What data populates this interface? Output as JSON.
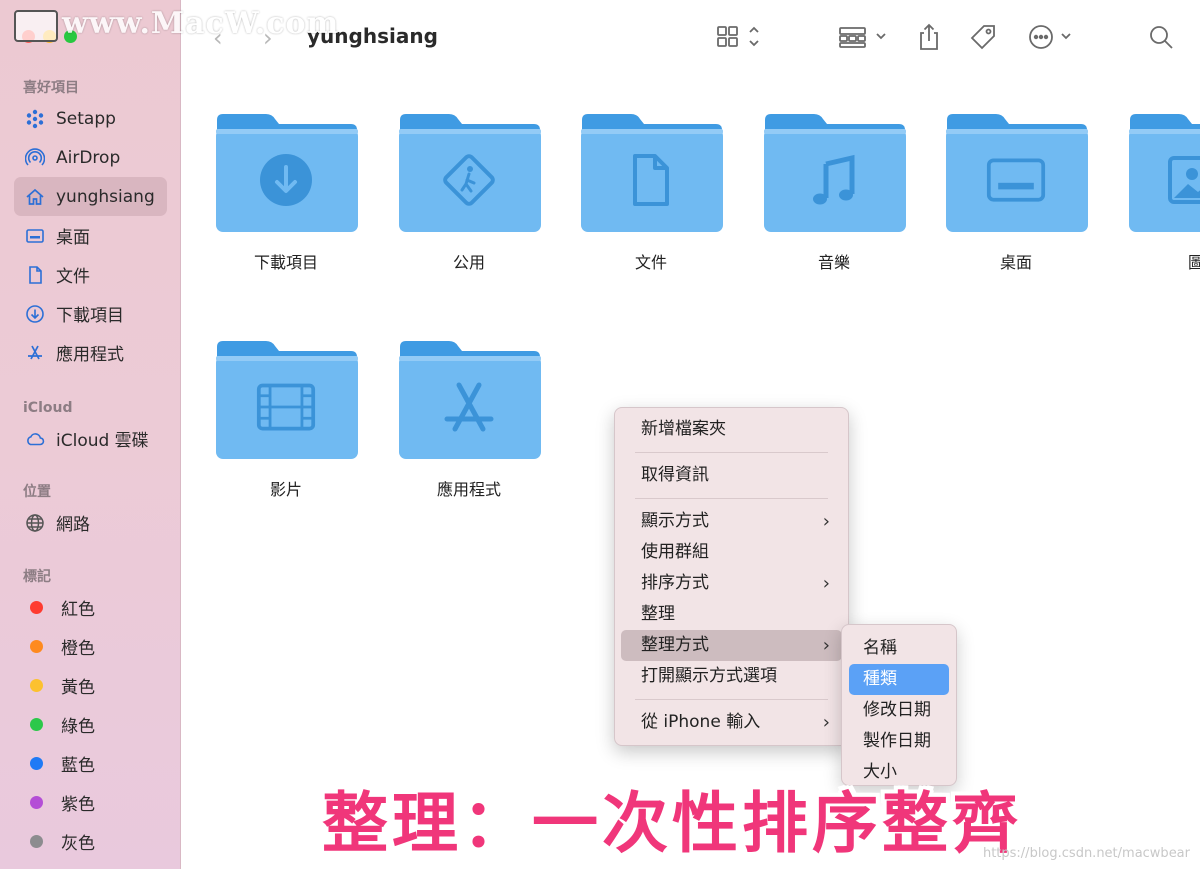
{
  "window": {
    "title": "yunghsiang"
  },
  "watermark": "www.MacW.com",
  "sidebar": {
    "sections": [
      {
        "heading": "喜好項目",
        "items": [
          {
            "label": "Setapp",
            "icon": "setapp-icon"
          },
          {
            "label": "AirDrop",
            "icon": "airdrop-icon"
          },
          {
            "label": "yunghsiang",
            "icon": "home-icon",
            "active": true
          },
          {
            "label": "桌面",
            "icon": "desktop-icon"
          },
          {
            "label": "文件",
            "icon": "document-icon"
          },
          {
            "label": "下載項目",
            "icon": "download-icon"
          },
          {
            "label": "應用程式",
            "icon": "applications-icon"
          }
        ]
      },
      {
        "heading": "iCloud",
        "items": [
          {
            "label": "iCloud 雲碟",
            "icon": "cloud-icon"
          }
        ]
      },
      {
        "heading": "位置",
        "items": [
          {
            "label": "網路",
            "icon": "network-icon"
          }
        ]
      },
      {
        "heading": "標記",
        "tags": [
          {
            "label": "紅色",
            "color": "#fe3b30"
          },
          {
            "label": "橙色",
            "color": "#fe8a1f"
          },
          {
            "label": "黃色",
            "color": "#fcc12f"
          },
          {
            "label": "綠色",
            "color": "#2cc84a"
          },
          {
            "label": "藍色",
            "color": "#1f7af5"
          },
          {
            "label": "紫色",
            "color": "#b44ed6"
          },
          {
            "label": "灰色",
            "color": "#8c8c8f"
          }
        ]
      }
    ]
  },
  "toolbar": {
    "buttons": [
      "view-icon-grid-icon",
      "group-icon",
      "share-icon",
      "tag-icon",
      "more-icon",
      "search-icon"
    ]
  },
  "folders": [
    {
      "label": "下載項目",
      "glyph": "download-glyph-icon"
    },
    {
      "label": "公用",
      "glyph": "public-glyph-icon"
    },
    {
      "label": "文件",
      "glyph": "document-glyph-icon"
    },
    {
      "label": "音樂",
      "glyph": "music-glyph-icon"
    },
    {
      "label": "桌面",
      "glyph": "desktop-glyph-icon"
    },
    {
      "label": "圖",
      "glyph": "pictures-glyph-icon"
    },
    {
      "label": "影片",
      "glyph": "movies-glyph-icon"
    },
    {
      "label": "應用程式",
      "glyph": "apps-glyph-icon"
    }
  ],
  "context_menu": {
    "items": [
      {
        "label": "新增檔案夾"
      },
      {
        "separator": true
      },
      {
        "label": "取得資訊"
      },
      {
        "separator": true
      },
      {
        "label": "顯示方式",
        "submenu": true
      },
      {
        "label": "使用群組"
      },
      {
        "label": "排序方式",
        "submenu": true
      },
      {
        "label": "整理"
      },
      {
        "label": "整理方式",
        "submenu": true,
        "highlighted": true
      },
      {
        "label": "打開顯示方式選項"
      },
      {
        "separator": true
      },
      {
        "label": "從 iPhone 輸入",
        "submenu": true
      }
    ]
  },
  "submenu": {
    "items": [
      {
        "label": "名稱"
      },
      {
        "label": "種類",
        "selected": true
      },
      {
        "label": "修改日期"
      },
      {
        "label": "製作日期"
      },
      {
        "label": "大小"
      }
    ]
  },
  "caption": "整理：一次性排序整齊",
  "credit": "https://blog.csdn.net/macwbear"
}
